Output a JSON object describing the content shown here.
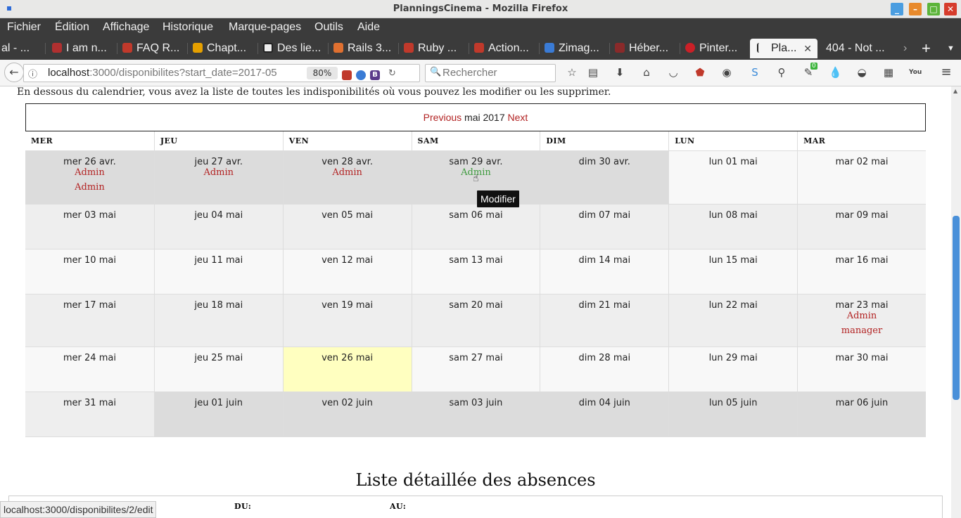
{
  "window": {
    "title": "PlanningsCinema - Mozilla Firefox"
  },
  "menu": [
    "Fichier",
    "Édition",
    "Affichage",
    "Historique",
    "Marque-pages",
    "Outils",
    "Aide"
  ],
  "tabs": [
    {
      "label": "al - ...",
      "color": "#c0392b"
    },
    {
      "label": "I am n...",
      "color": "#b03030"
    },
    {
      "label": "FAQ R...",
      "color": "#c0392b"
    },
    {
      "label": "Chapt...",
      "color": "#e6a000"
    },
    {
      "label": "Des lie...",
      "color": "#222222"
    },
    {
      "label": "Rails 3...",
      "color": "#e07030"
    },
    {
      "label": "Ruby ...",
      "color": "#c0392b"
    },
    {
      "label": "Action...",
      "color": "#c0392b"
    },
    {
      "label": "Zimag...",
      "color": "#3a7bd5"
    },
    {
      "label": "Héber...",
      "color": "#8a2a2a"
    },
    {
      "label": "Pinter...",
      "color": "#cb2027"
    },
    {
      "label": "Pla...",
      "color": "#222222",
      "active": true
    },
    {
      "label": "404 - Not ...",
      "color": "#888888"
    }
  ],
  "nav": {
    "url_host": "localhost",
    "url_path": ":3000/disponibilites?start_date=2017-05",
    "zoom": "80%",
    "search_placeholder": "Rechercher",
    "ext_badge": "0"
  },
  "page": {
    "intro": "En dessous du calendrier, vous avez la liste de toutes les indisponibilités où vous pouvez les modifier ou les supprimer.",
    "cal_prev": "Previous",
    "cal_month": "mai 2017",
    "cal_next": "Next",
    "dow": [
      "MER",
      "JEU",
      "VEN",
      "SAM",
      "DIM",
      "LUN",
      "MAR"
    ],
    "weeks": [
      [
        {
          "label": "mer 26 avr.",
          "events": [
            "Admin",
            "Admin"
          ],
          "bg": "prev"
        },
        {
          "label": "jeu 27 avr.",
          "events": [
            "Admin"
          ],
          "bg": "prev"
        },
        {
          "label": "ven 28 avr.",
          "events": [
            "Admin"
          ],
          "bg": "prev"
        },
        {
          "label": "sam 29 avr.",
          "events": [
            "Admin"
          ],
          "bg": "prev",
          "hover": true
        },
        {
          "label": "dim 30 avr.",
          "events": [],
          "bg": "prev"
        },
        {
          "label": "lun 01 mai",
          "events": [],
          "bg": "light"
        },
        {
          "label": "mar 02 mai",
          "events": [],
          "bg": "light"
        }
      ],
      [
        {
          "label": "mer 03 mai",
          "events": [],
          "bg": "grey"
        },
        {
          "label": "jeu 04 mai",
          "events": [],
          "bg": "grey"
        },
        {
          "label": "ven 05 mai",
          "events": [],
          "bg": "grey"
        },
        {
          "label": "sam 06 mai",
          "events": [],
          "bg": "grey"
        },
        {
          "label": "dim 07 mai",
          "events": [],
          "bg": "grey"
        },
        {
          "label": "lun 08 mai",
          "events": [],
          "bg": "grey"
        },
        {
          "label": "mar 09 mai",
          "events": [],
          "bg": "grey"
        }
      ],
      [
        {
          "label": "mer 10 mai",
          "events": [],
          "bg": "light"
        },
        {
          "label": "jeu 11 mai",
          "events": [],
          "bg": "light"
        },
        {
          "label": "ven 12 mai",
          "events": [],
          "bg": "light"
        },
        {
          "label": "sam 13 mai",
          "events": [],
          "bg": "light"
        },
        {
          "label": "dim 14 mai",
          "events": [],
          "bg": "light"
        },
        {
          "label": "lun 15 mai",
          "events": [],
          "bg": "light"
        },
        {
          "label": "mar 16 mai",
          "events": [],
          "bg": "light"
        }
      ],
      [
        {
          "label": "mer 17 mai",
          "events": [],
          "bg": "grey"
        },
        {
          "label": "jeu 18 mai",
          "events": [],
          "bg": "grey"
        },
        {
          "label": "ven 19 mai",
          "events": [],
          "bg": "grey"
        },
        {
          "label": "sam 20 mai",
          "events": [],
          "bg": "grey"
        },
        {
          "label": "dim 21 mai",
          "events": [],
          "bg": "grey"
        },
        {
          "label": "lun 22 mai",
          "events": [],
          "bg": "grey"
        },
        {
          "label": "mar 23 mai",
          "events": [
            "Admin",
            "manager"
          ],
          "bg": "grey"
        }
      ],
      [
        {
          "label": "mer 24 mai",
          "events": [],
          "bg": "light"
        },
        {
          "label": "jeu 25 mai",
          "events": [],
          "bg": "light"
        },
        {
          "label": "ven 26 mai",
          "events": [],
          "bg": "today"
        },
        {
          "label": "sam 27 mai",
          "events": [],
          "bg": "light"
        },
        {
          "label": "dim 28 mai",
          "events": [],
          "bg": "light"
        },
        {
          "label": "lun 29 mai",
          "events": [],
          "bg": "light"
        },
        {
          "label": "mar 30 mai",
          "events": [],
          "bg": "light"
        }
      ],
      [
        {
          "label": "mer 31 mai",
          "events": [],
          "bg": "grey"
        },
        {
          "label": "jeu 01 juin",
          "events": [],
          "bg": "prev"
        },
        {
          "label": "ven 02 juin",
          "events": [],
          "bg": "prev"
        },
        {
          "label": "sam 03 juin",
          "events": [],
          "bg": "prev"
        },
        {
          "label": "dim 04 juin",
          "events": [],
          "bg": "prev"
        },
        {
          "label": "lun 05 juin",
          "events": [],
          "bg": "prev"
        },
        {
          "label": "mar 06 juin",
          "events": [],
          "bg": "prev"
        }
      ]
    ],
    "tooltip": "Modifier",
    "list_title": "Liste détaillée des absences",
    "list_headers": [
      "DU:",
      "AU:"
    ]
  },
  "status_url": "localhost:3000/disponibilites/2/edit",
  "colors": {
    "link": "#b22222",
    "hover_link": "#3c9a3c",
    "today": "#ffffc0",
    "scroll_thumb": "#4a90d9"
  }
}
